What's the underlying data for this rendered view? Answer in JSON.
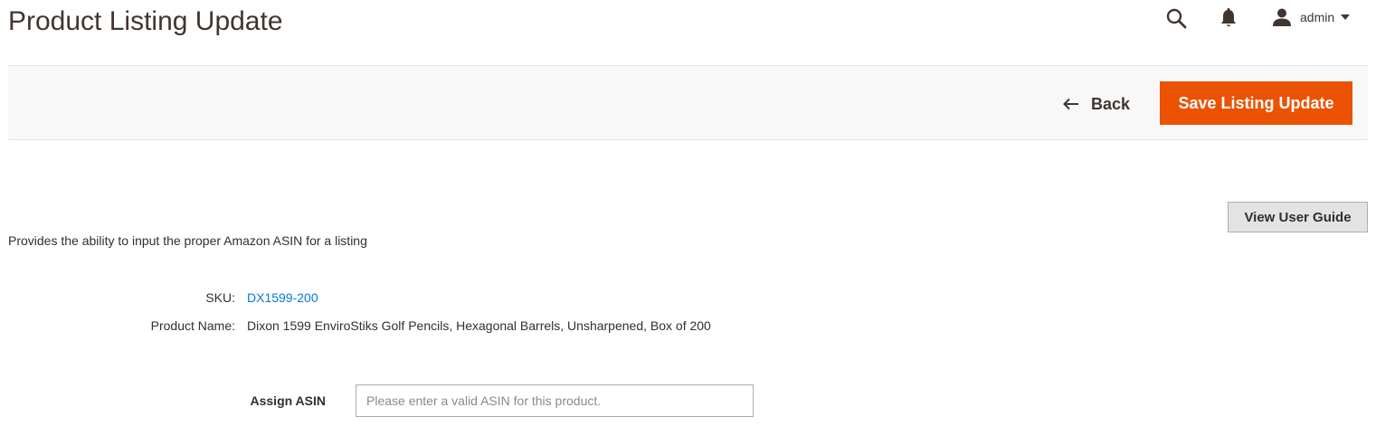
{
  "page": {
    "title": "Product Listing Update"
  },
  "header": {
    "search_icon": "search-icon",
    "notifications_icon": "bell-icon",
    "user_icon": "user-icon",
    "user_name": "admin"
  },
  "action_bar": {
    "back_label": "Back",
    "save_label": "Save Listing Update"
  },
  "content": {
    "guide_button_label": "View User Guide",
    "description": "Provides the ability to input the proper Amazon ASIN for a listing",
    "sku_label": "SKU:",
    "sku_value": "DX1599-200",
    "product_name_label": "Product Name:",
    "product_name_value": "Dixon 1599 EnviroStiks Golf Pencils, Hexagonal Barrels, Unsharpened, Box of 200",
    "asin_label": "Assign ASIN",
    "asin_value": "",
    "asin_placeholder": "Please enter a valid ASIN for this product."
  },
  "colors": {
    "accent": "#eb5202",
    "link": "#007bdb",
    "title": "#41362f",
    "action_bar_bg": "#f8f8f8"
  }
}
